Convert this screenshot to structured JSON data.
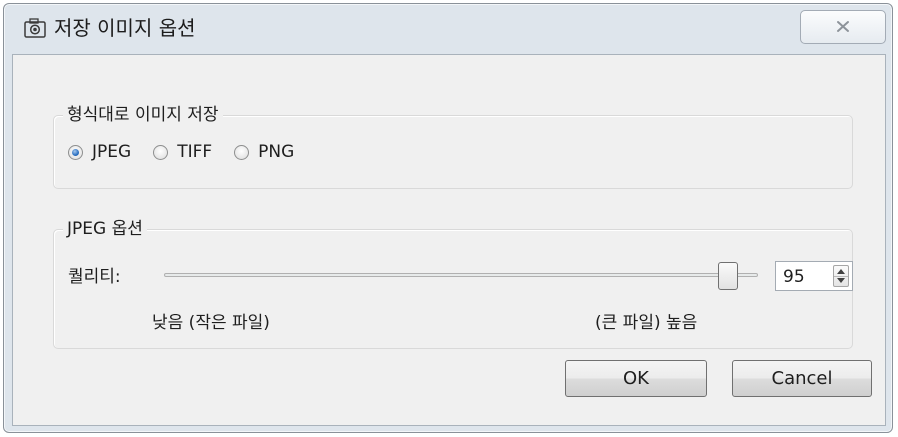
{
  "window": {
    "title": "저장 이미지 옵션",
    "title_icon": "camera-icon",
    "close_icon": "close-icon"
  },
  "format_group": {
    "legend": "형식대로 이미지 저장",
    "options": [
      {
        "label": "JPEG",
        "checked": true
      },
      {
        "label": "TIFF",
        "checked": false
      },
      {
        "label": "PNG",
        "checked": false
      }
    ]
  },
  "jpeg_group": {
    "legend": "JPEG 옵션",
    "quality_label": "퀄리티:",
    "quality_value": "95",
    "slider_fraction": 0.95,
    "hint_low": "낮음 (작은 파일)",
    "hint_high": "(큰 파일) 높음"
  },
  "buttons": {
    "ok": "OK",
    "cancel": "Cancel"
  },
  "colors": {
    "window_frame": "#dee5ec",
    "client_bg": "#f0f0f0",
    "radio_selected": "#2a6fc1"
  }
}
